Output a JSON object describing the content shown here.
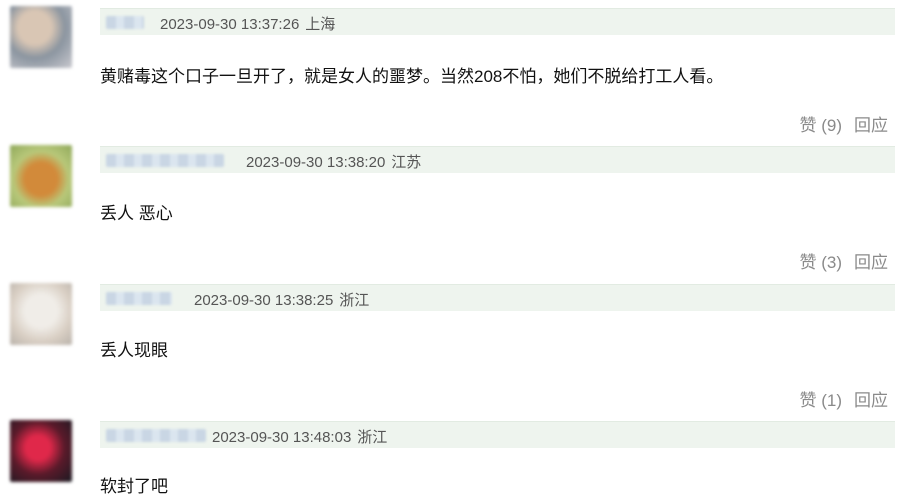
{
  "comments": [
    {
      "timestamp": "2023-09-30 13:37:26",
      "location": "上海",
      "text": "黄赌毒这个口子一旦开了，就是女人的噩梦。当然208不怕，她们不脱给打工人看。",
      "like_label": "赞 (9)",
      "reply_label": "回应"
    },
    {
      "timestamp": "2023-09-30 13:38:20",
      "location": "江苏",
      "text": "丢人 恶心",
      "like_label": "赞 (3)",
      "reply_label": "回应"
    },
    {
      "timestamp": "2023-09-30 13:38:25",
      "location": "浙江",
      "text": "丢人现眼",
      "like_label": "赞 (1)",
      "reply_label": "回应"
    },
    {
      "timestamp": "2023-09-30 13:48:03",
      "location": "浙江",
      "text": "软封了吧",
      "like_label": "",
      "reply_label": ""
    }
  ]
}
